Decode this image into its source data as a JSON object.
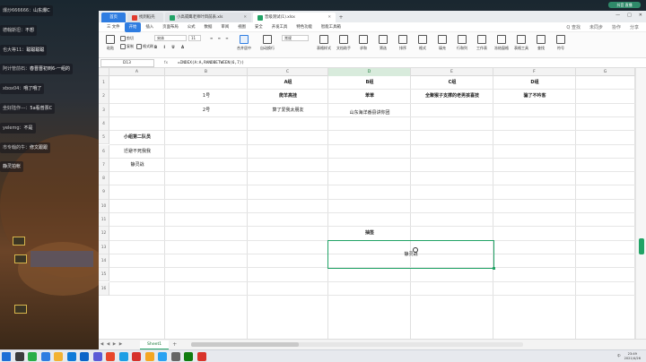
{
  "stream": {
    "badge": "抖音 直播",
    "chat": [
      {
        "user": "爆炒666666：",
        "text": "山东爆C"
      },
      {
        "user": "德翰斯坦：",
        "text": "不想"
      },
      {
        "user": "也大等11：",
        "text": "聪聪聪聪"
      },
      {
        "user": "阿计管前石：",
        "text": "春晋晋初到6-一组的"
      },
      {
        "user": "xbox04：",
        "text": "哦了哦了"
      },
      {
        "user": "坐好陆作---：",
        "text": "5a看普票C"
      },
      {
        "user": "yelemg：",
        "text": "不是"
      },
      {
        "user": "市专翰的牛：",
        "text": "修文跟跟"
      },
      {
        "user": "",
        "text": "静灵拍帐"
      }
    ]
  },
  "window": {
    "tabs": [
      {
        "label": "首页",
        "kind": "home"
      },
      {
        "label": "找到稻壳",
        "kind": "doc"
      },
      {
        "label": "小高或鹰老师叶目前表.xls",
        "kind": "doc"
      },
      {
        "label": "晋级测试(1).xlsx",
        "kind": "active"
      }
    ],
    "new_tab": "+",
    "controls": [
      "—",
      "□",
      "✕"
    ]
  },
  "menubar": {
    "items": [
      "三 文件",
      "开始",
      "插入",
      "页面布局",
      "公式",
      "数据",
      "审阅",
      "视图",
      "安全",
      "开发工具",
      "特色功能",
      "智能工具箱"
    ],
    "active_index": 1,
    "search": "Q 查找",
    "right": [
      "未同步",
      "协作",
      "分享"
    ]
  },
  "ribbon": {
    "paste": "粘贴",
    "cut": "剪切",
    "copy": "复制",
    "format_painter": "格式刷",
    "font": "宋体",
    "font_size": "11",
    "merge": "合并居中",
    "wrap": "自动换行",
    "number_format": "常规",
    "items": [
      "表格样式",
      "文档助手",
      "求和",
      "筛选",
      "排序",
      "格式",
      "填充",
      "行和列",
      "工作表",
      "冻结窗格",
      "表格工具",
      "查找",
      "符号"
    ]
  },
  "formula_bar": {
    "name_box": "D13",
    "fx": "fx",
    "formula": "=INDEX(A:A,RANDBETWEEN(6,7))"
  },
  "grid": {
    "columns": [
      "A",
      "B",
      "C",
      "D",
      "E",
      "F",
      "G"
    ],
    "selected_column": "D",
    "rows": [
      "1",
      "2",
      "3",
      "4",
      "5",
      "6",
      "7",
      "8",
      "9",
      "10",
      "11",
      "12",
      "13",
      "14",
      "15",
      "16"
    ],
    "cells": {
      "C1": "A组",
      "D1": "B组",
      "E1": "C组",
      "F1": "D组",
      "B2": "1号",
      "C2": "爬羊高挂",
      "D2": "苯苯",
      "E2": "全聚猴子支撑的老男孩喜技",
      "F2": "骗了不吟客",
      "B3": "2号",
      "C3": "算了爱我太朋友",
      "D3": "山东海洋番县讲你团",
      "A5": "小组第二队员",
      "A6": "迁避不死我我",
      "A7": "静灵战",
      "D12": "抽签",
      "D13": "静灵战"
    }
  },
  "sheets": {
    "nav": [
      "◀",
      "◀",
      "▶",
      "▶"
    ],
    "tabs": [
      "Sheet1"
    ],
    "add": "+"
  },
  "taskbar": {
    "time": "23:49",
    "date": "2021/4/26",
    "lang": "中",
    "apps": [
      "start",
      "search",
      "wechat",
      "browser",
      "folder",
      "edge",
      "mail",
      "store",
      "music",
      "photos",
      "wps",
      "files",
      "qq",
      "settings",
      "xbox",
      "netease"
    ]
  },
  "colors": {
    "accent": "#21a366",
    "wps_blue": "#2f7de1"
  }
}
